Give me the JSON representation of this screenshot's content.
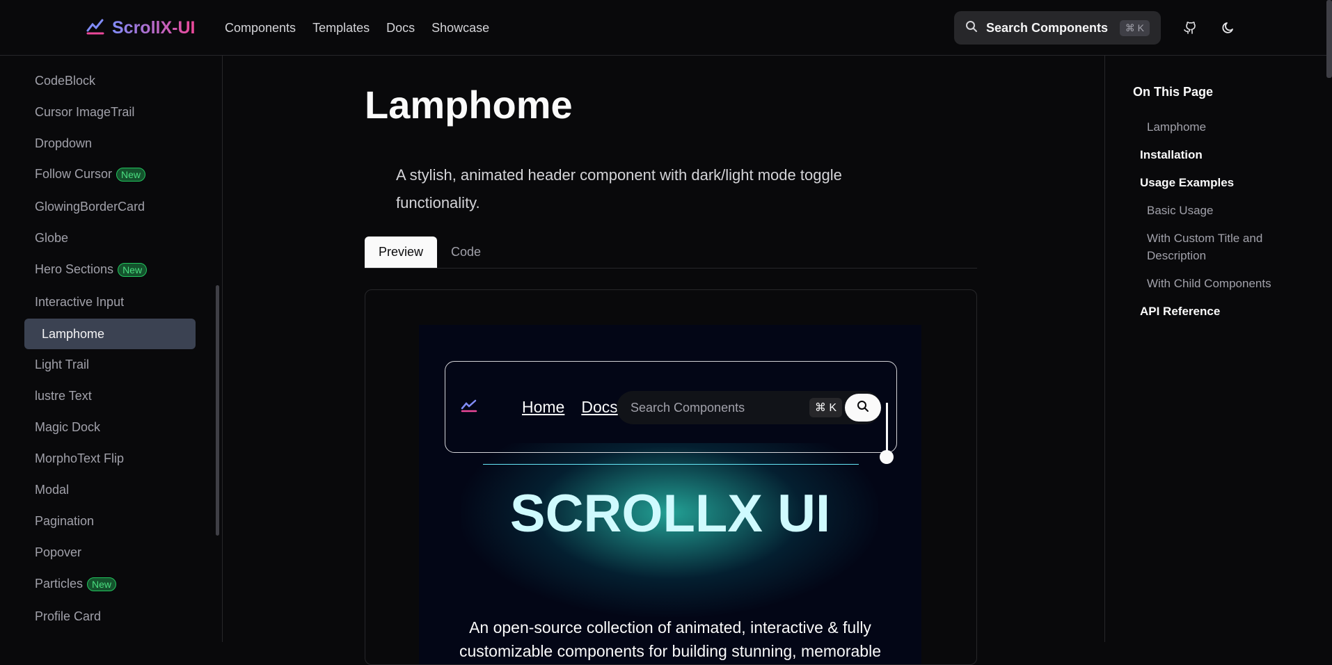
{
  "header": {
    "brand": "ScrollX-UI",
    "nav": [
      "Components",
      "Templates",
      "Docs",
      "Showcase"
    ],
    "search_label": "Search Components",
    "search_kbd": "⌘ K"
  },
  "sidebar": {
    "items": [
      {
        "label": "CodeBlock",
        "badge": ""
      },
      {
        "label": "Cursor ImageTrail",
        "badge": ""
      },
      {
        "label": "Dropdown",
        "badge": ""
      },
      {
        "label": "Follow Cursor",
        "badge": "New"
      },
      {
        "label": "GlowingBorderCard",
        "badge": ""
      },
      {
        "label": "Globe",
        "badge": ""
      },
      {
        "label": "Hero Sections",
        "badge": "New"
      },
      {
        "label": "Interactive Input",
        "badge": ""
      },
      {
        "label": "Lamphome",
        "badge": ""
      },
      {
        "label": "Light Trail",
        "badge": ""
      },
      {
        "label": "lustre Text",
        "badge": ""
      },
      {
        "label": "Magic Dock",
        "badge": ""
      },
      {
        "label": "MorphoText Flip",
        "badge": ""
      },
      {
        "label": "Modal",
        "badge": ""
      },
      {
        "label": "Pagination",
        "badge": ""
      },
      {
        "label": "Popover",
        "badge": ""
      },
      {
        "label": "Particles",
        "badge": "New"
      },
      {
        "label": "Profile Card",
        "badge": ""
      }
    ]
  },
  "main": {
    "title": "Lamphome",
    "description": "A stylish, animated header component with dark/light mode toggle functionality.",
    "tabs": [
      "Preview",
      "Code"
    ]
  },
  "demo": {
    "links": [
      "Home",
      "Docs"
    ],
    "search_placeholder": "Search Components",
    "kbd": "⌘ K",
    "heading": "SCROLLX UI",
    "subtitle": "An open-source collection of animated, interactive & fully customizable components for building stunning, memorable"
  },
  "toc": {
    "title": "On This Page",
    "items": [
      "Lamphome",
      "Installation",
      "Usage Examples",
      "Basic Usage",
      "With Custom Title and Description",
      "With Child Components",
      "API Reference"
    ]
  }
}
